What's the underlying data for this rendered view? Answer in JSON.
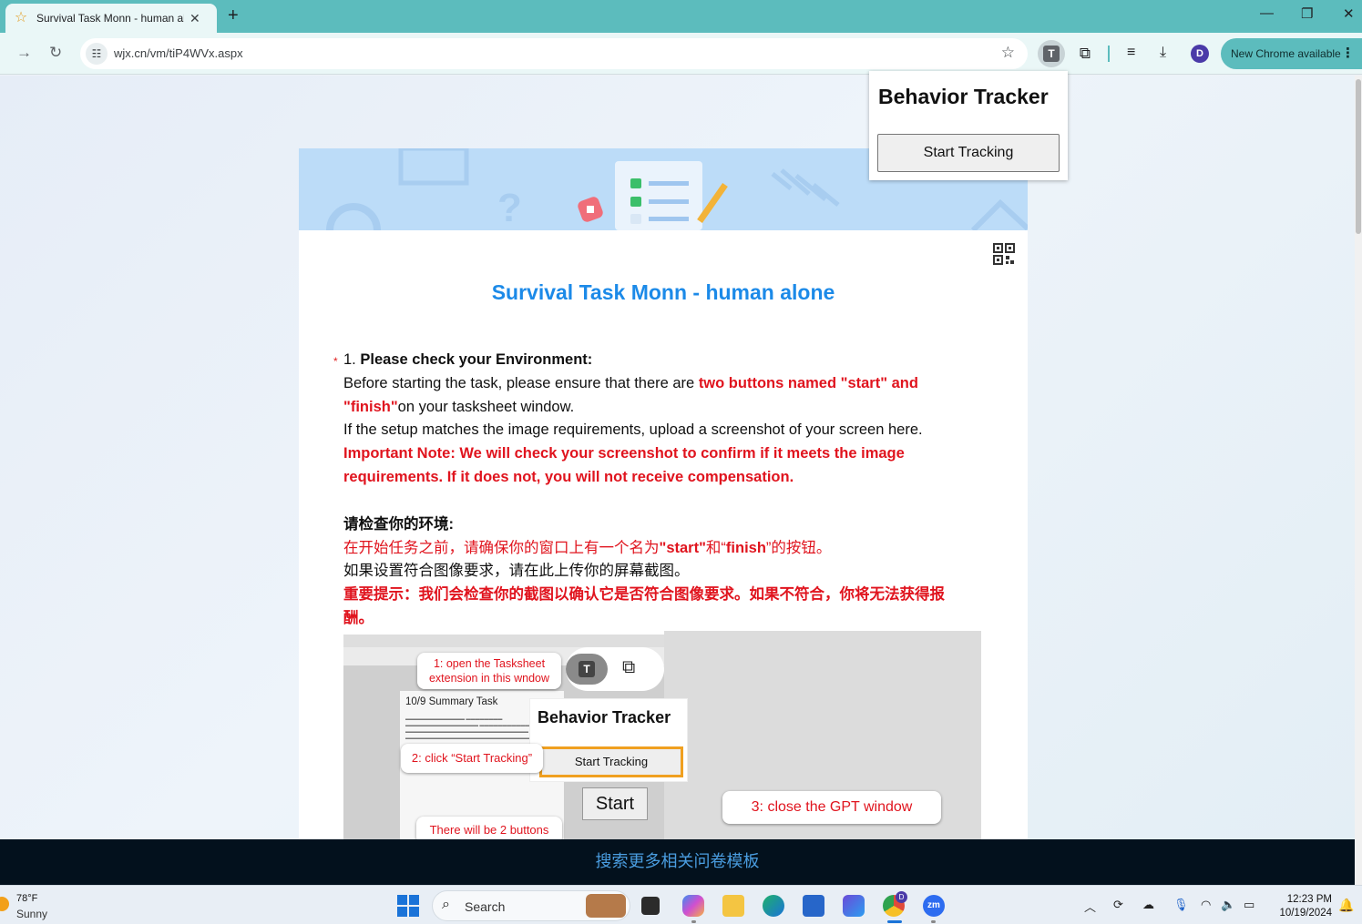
{
  "browser": {
    "tab_title": "Survival Task Monn - human alone",
    "tab_close": "✕",
    "new_tab": "+",
    "url": "wjx.cn/vm/tiP4WVx.aspx",
    "profile_initial": "D",
    "update_label": "New Chrome available",
    "extension_letter": "T"
  },
  "popup": {
    "title": "Behavior Tracker",
    "button": "Start Tracking"
  },
  "survey": {
    "title": "Survival Task Monn - human alone",
    "question": {
      "required_mark": "*",
      "number": "1.",
      "heading": "Please check your Environment:",
      "en_line1_prefix": "Before starting the task, please ensure that there are ",
      "en_line1_red": "two buttons named \"start\" and \"finish\"",
      "en_line1_suffix": "on your tasksheet window.",
      "en_line2": "If the setup matches the image requirements, upload a screenshot of your screen here.",
      "en_note": "Important Note: We will check your screenshot to confirm if it meets the image requirements. If it does not, you will not receive compensation.",
      "cn_heading": "请检查你的环境:",
      "cn_line1_a": "在开始任务之前，请确保你的窗口上有一个名为",
      "cn_line1_b": "\"start\"",
      "cn_line1_c": "和“",
      "cn_line1_d": "finish",
      "cn_line1_e": "”的按钮。",
      "cn_line2": "如果设置符合图像要求，请在此上传你的屏幕截图。",
      "cn_note": "重要提示：我们会检查你的截图以确认它是否符合图像要求。如果不符合，你将无法获得报酬。"
    },
    "image": {
      "step1": "1: open the Tasksheet extension in this wndow",
      "step2": "2: click “Start Tracking”",
      "step3": "3: close the GPT window",
      "note": "There will be 2 buttons",
      "card_title": "10/9 Summary Task",
      "ext_letter": "T",
      "bt_title": "Behavior Tracker",
      "bt_button": "Start Tracking",
      "start_button": "Start"
    }
  },
  "footer": {
    "link": "搜索更多相关问卷模板"
  },
  "taskbar": {
    "temp": "78°F",
    "condition": "Sunny",
    "search": "Search",
    "time": "12:23 PM",
    "date": "10/19/2024",
    "zoom_label": "zm",
    "chrome_badge": "D"
  }
}
